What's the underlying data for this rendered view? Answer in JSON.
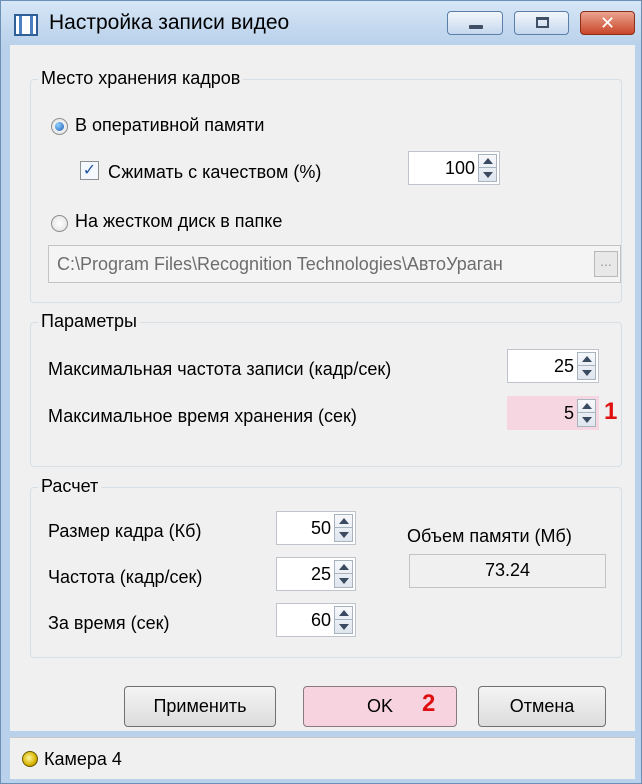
{
  "window": {
    "title": "Настройка записи видео",
    "controls": {
      "minimize": "minimize",
      "maximize": "maximize",
      "close": "✕"
    }
  },
  "storage": {
    "legend": "Место хранения кадров",
    "ram_label": "В оперативной памяти",
    "ram_selected": true,
    "compress_label": "Сжимать с качеством (%)",
    "compress_checked": true,
    "compress_value": "100",
    "disk_label": "На жестком диск в папке",
    "disk_selected": false,
    "folder_path": "C:\\Program Files\\Recognition Technologies\\АвтоУраган",
    "browse_label": "..."
  },
  "params": {
    "legend": "Параметры",
    "max_rate_label": "Максимальная частота  записи (кадр/сек)",
    "max_rate_value": "25",
    "max_time_label": "Максимальное время  хранения (сек)",
    "max_time_value": "5"
  },
  "calc": {
    "legend": "Расчет",
    "frame_size_label": "Размер кадра (Кб)",
    "frame_size_value": "50",
    "rate_label": "Частота (кадр/сек)",
    "rate_value": "25",
    "time_label": "За время (сек)",
    "time_value": "60",
    "memory_label": "Объем памяти (Мб)",
    "memory_value": "73.24"
  },
  "buttons": {
    "apply": "Применить",
    "ok": "OK",
    "cancel": "Отмена"
  },
  "markers": {
    "one": "1",
    "two": "2"
  },
  "status": {
    "camera": "Камера 4"
  },
  "colors": {
    "highlight": "#f6d6e0",
    "marker": "#e01010",
    "frame": "#b9d1ea"
  }
}
